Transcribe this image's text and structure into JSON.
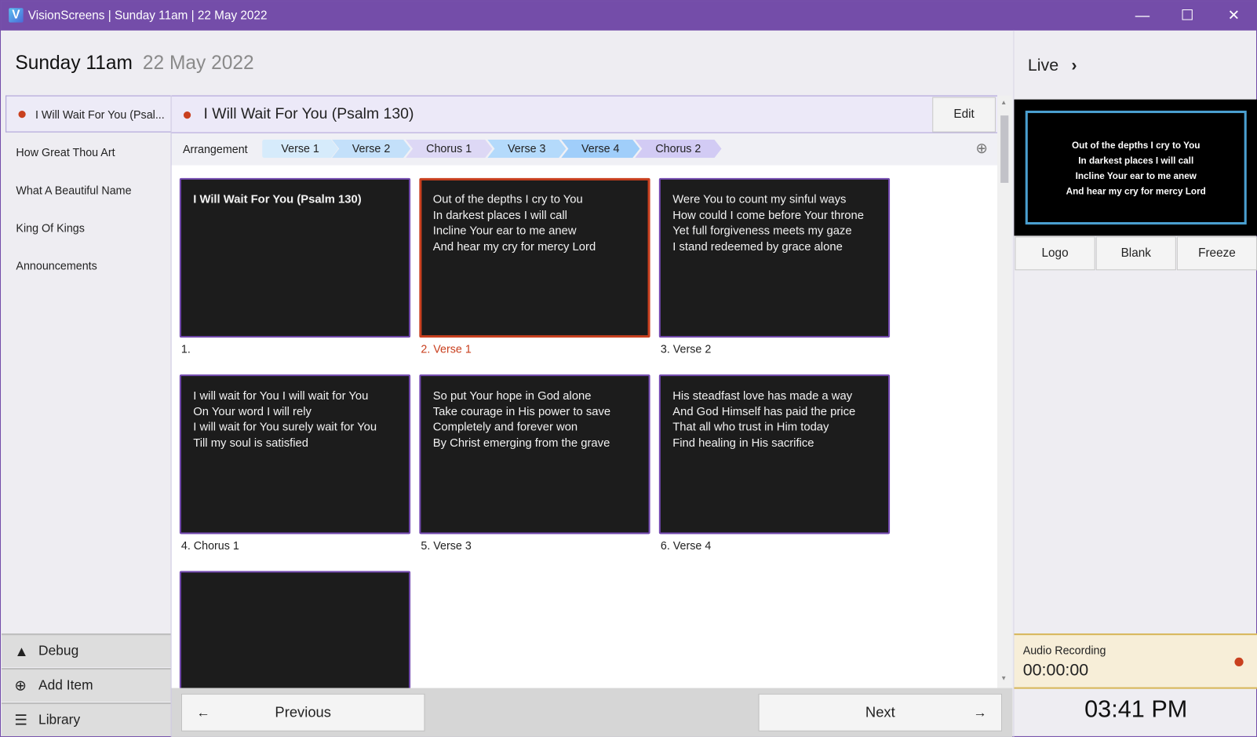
{
  "window": {
    "app_icon": "V",
    "title": "VisionScreens | Sunday 11am | 22 May 2022",
    "minimize": "—",
    "maximize": "☐",
    "close": "✕"
  },
  "header": {
    "title": "Sunday 11am",
    "date": "22 May 2022"
  },
  "sidebar": {
    "items": [
      {
        "label": "I Will Wait For You (Psal..."
      },
      {
        "label": "How Great Thou Art"
      },
      {
        "label": "What A Beautiful Name"
      },
      {
        "label": "King Of Kings"
      },
      {
        "label": "Announcements"
      }
    ],
    "bottom": {
      "debug": "Debug",
      "add_item": "Add Item",
      "library": "Library"
    }
  },
  "song": {
    "title": "I Will Wait For You (Psalm 130)",
    "edit_label": "Edit"
  },
  "arrangement": {
    "label": "Arrangement",
    "chips": [
      {
        "label": "Verse 1",
        "color": "#D6EBFB"
      },
      {
        "label": "Verse 2",
        "color": "#C3E0FA"
      },
      {
        "label": "Chorus 1",
        "color": "#DDD8F5"
      },
      {
        "label": "Verse 3",
        "color": "#B4DAFB"
      },
      {
        "label": "Verse 4",
        "color": "#A0CEFA"
      },
      {
        "label": "Chorus 2",
        "color": "#D2CBF4"
      }
    ]
  },
  "slides": [
    {
      "text": "I Will Wait For You (Psalm 130)",
      "label": "1."
    },
    {
      "text": "Out of the depths I cry to You\nIn darkest places I will call\nIncline Your ear to me anew\nAnd hear my cry for mercy Lord",
      "label": "2. Verse 1"
    },
    {
      "text": "Were You to count my sinful ways\nHow could I come before Your throne\nYet full forgiveness meets my gaze\nI stand redeemed by grace alone",
      "label": "3. Verse 2"
    },
    {
      "text": "I will wait for You I will wait for You\nOn Your word I will rely\nI will wait for You surely wait for You\nTill my soul is satisfied",
      "label": "4. Chorus 1"
    },
    {
      "text": "So put Your hope in God alone\nTake courage in His power to save\nCompletely and forever won\nBy Christ emerging from the grave",
      "label": "5. Verse 3"
    },
    {
      "text": "His steadfast love has made a way\nAnd God Himself has paid the price\nThat all who trust in Him today\nFind healing in His sacrifice",
      "label": "6. Verse 4"
    },
    {
      "text": "",
      "label": ""
    }
  ],
  "nav": {
    "previous": "Previous",
    "next": "Next"
  },
  "live": {
    "title": "Live",
    "preview_text": "Out of the depths I cry to You\nIn darkest places I will call\nIncline Your ear to me anew\nAnd hear my cry for mercy Lord",
    "logo": "Logo",
    "blank": "Blank",
    "freeze": "Freeze"
  },
  "audio": {
    "label": "Audio Recording",
    "time": "00:00:00"
  },
  "clock": "03:41 PM",
  "colors": {
    "accent": "#744DA9",
    "live_red": "#C9401F",
    "preview_border": "#4A9FD0"
  }
}
